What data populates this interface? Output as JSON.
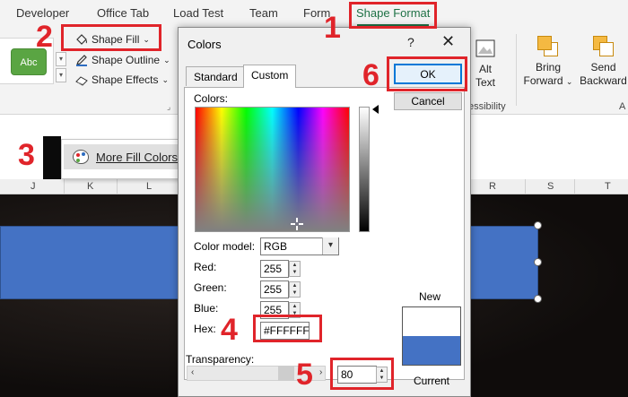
{
  "ribbon": {
    "tabs": [
      {
        "label": "Developer"
      },
      {
        "label": "Office Tab"
      },
      {
        "label": "Load Test"
      },
      {
        "label": "Team"
      },
      {
        "label": "Form"
      },
      {
        "label": "Shape Format"
      }
    ],
    "active_tab": "Shape Format",
    "style_preview_label": "Abc",
    "shape_fill_label": "Shape Fill",
    "shape_outline_label": "Shape Outline",
    "shape_effects_label": "Shape Effects",
    "alt_text_label": "Alt Text",
    "bring_forward_label": "Bring Forward",
    "send_backward_label": "Send Backward",
    "accessibility_partial": "essibility",
    "arrange_partial": "A",
    "accent_color": "#1e7145"
  },
  "fill_menu": {
    "more_fill_colors_label": "More Fill Colors..."
  },
  "sheet": {
    "columns": [
      "J",
      "K",
      "L",
      "R",
      "S",
      "T"
    ],
    "shape_color": "#4472c4"
  },
  "dialog": {
    "title": "Colors",
    "help": "?",
    "close": "✕",
    "tabs": [
      {
        "label": "Standard"
      },
      {
        "label": "Custom"
      }
    ],
    "active_tab": "Custom",
    "colors_label": "Colors:",
    "color_model_label": "Color model:",
    "color_model_value": "RGB",
    "red_label": "Red:",
    "red_value": "255",
    "green_label": "Green:",
    "green_value": "255",
    "blue_label": "Blue:",
    "blue_value": "255",
    "hex_label": "Hex:",
    "hex_value": "#FFFFFF",
    "transparency_label": "Transparency:",
    "transparency_value": "80",
    "ok_label": "OK",
    "cancel_label": "Cancel",
    "new_label": "New",
    "current_label": "Current",
    "new_color": "#ffffff",
    "current_color": "#4472c4"
  },
  "annotations": {
    "step1": "1",
    "step2": "2",
    "step3": "3",
    "step4": "4",
    "step5": "5",
    "step6": "6",
    "color": "#e0242a"
  }
}
